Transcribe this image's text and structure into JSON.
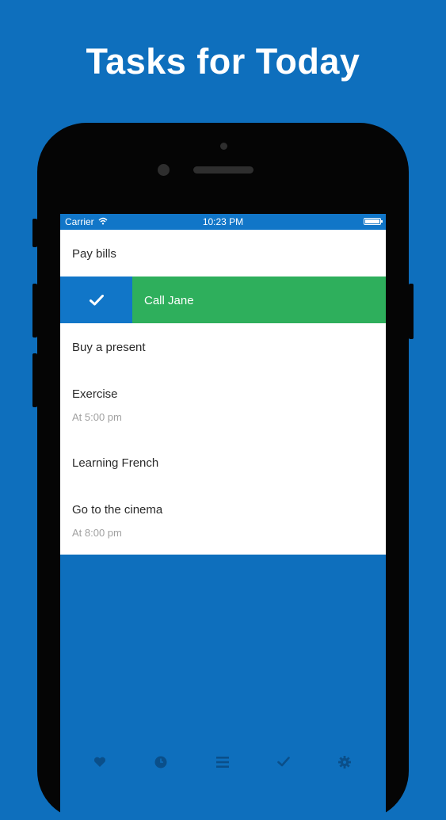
{
  "headline": "Tasks for Today",
  "status_bar": {
    "carrier": "Carrier",
    "time": "10:23 PM"
  },
  "tasks": [
    {
      "title": "Pay bills",
      "time": ""
    },
    {
      "title": "Call Jane",
      "time": "",
      "state": "swiped-complete"
    },
    {
      "title": "Buy a present",
      "time": ""
    },
    {
      "title": "Exercise",
      "time": "At 5:00 pm"
    },
    {
      "title": "Learning French",
      "time": ""
    },
    {
      "title": "Go to the cinema",
      "time": "At 8:00 pm"
    }
  ],
  "tabbar": {
    "items": [
      {
        "icon": "heart-icon"
      },
      {
        "icon": "clock-icon"
      },
      {
        "icon": "list-icon",
        "active": true
      },
      {
        "icon": "check-icon"
      },
      {
        "icon": "gear-icon"
      }
    ]
  },
  "colors": {
    "background": "#0e6fbd",
    "status_bar": "#1176c8",
    "complete_green": "#2eaf5c",
    "time_gray": "#a0a0a0",
    "tab_icon": "#0a4f8a"
  }
}
